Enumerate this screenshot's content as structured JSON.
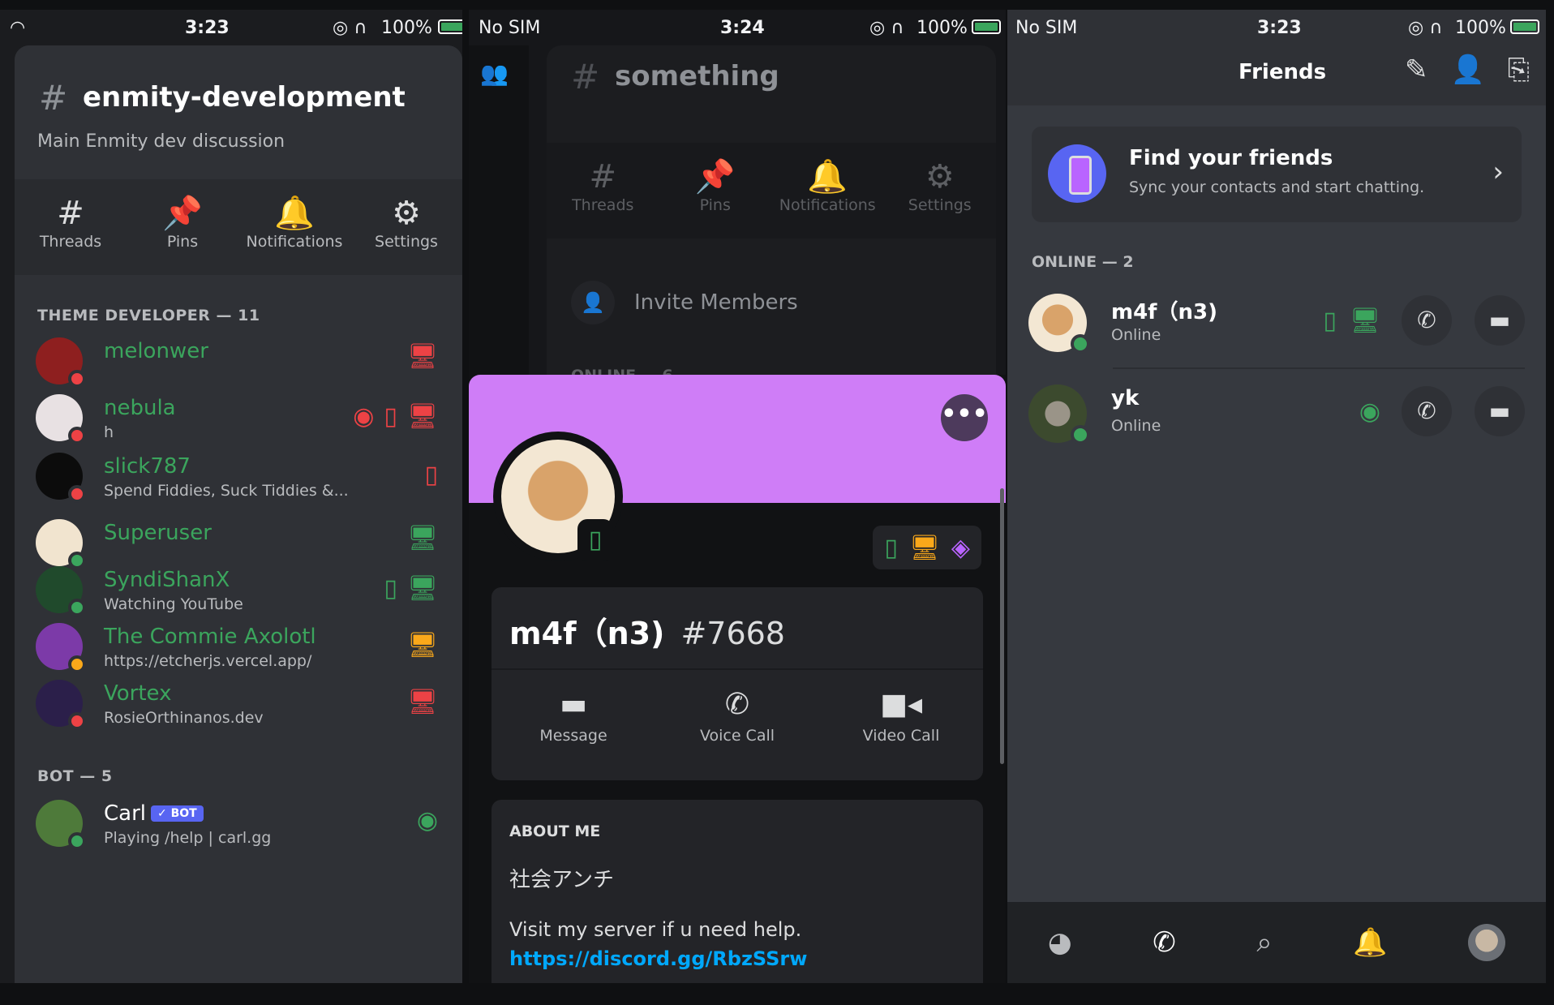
{
  "panel1": {
    "status": {
      "time": "3:23",
      "battery": "100%"
    },
    "channel": {
      "hash": "#",
      "name": "enmity-development",
      "description": "Main Enmity dev discussion"
    },
    "tabs": [
      {
        "label": "Threads",
        "icon": "#"
      },
      {
        "label": "Pins",
        "icon": "📌"
      },
      {
        "label": "Notifications",
        "icon": "🔔"
      },
      {
        "label": "Settings",
        "icon": "⚙"
      }
    ],
    "section_theme": "THEME DEVELOPER — 11",
    "members": [
      {
        "name": "melonwer",
        "sub": ""
      },
      {
        "name": "nebula",
        "sub": "h"
      },
      {
        "name": "slick787",
        "sub": "Spend Fiddies, Suck Tiddies &..."
      },
      {
        "name": "Superuser",
        "sub": ""
      },
      {
        "name": "SyndiShanX",
        "sub": "Watching YouTube"
      },
      {
        "name": "The Commie Axolotl",
        "sub": "https://etcherjs.vercel.app/"
      },
      {
        "name": "Vortex",
        "sub": "RosieOrthinanos.dev"
      }
    ],
    "section_bot": "BOT — 5",
    "bot": {
      "name": "Carl",
      "badge": "✓ BOT",
      "sub": "Playing /help | carl.gg"
    }
  },
  "panel2": {
    "status": {
      "carrier": "No SIM",
      "time": "3:24",
      "battery": "100%"
    },
    "channel": {
      "hash": "#",
      "name": "something"
    },
    "tabs": [
      {
        "label": "Threads",
        "icon": "#"
      },
      {
        "label": "Pins",
        "icon": "📌"
      },
      {
        "label": "Notifications",
        "icon": "🔔"
      },
      {
        "label": "Settings",
        "icon": "⚙"
      }
    ],
    "invite": "Invite Members",
    "online": "ONLINE — 6",
    "profile": {
      "more": "•••",
      "username": "m4f（n3)",
      "discriminator": "#7668",
      "actions": [
        "Message",
        "Voice Call",
        "Video Call"
      ],
      "about_title": "ABOUT ME",
      "about_jp": "社会アンチ",
      "about_text": "Visit my server if u need help.",
      "about_link": "https://discord.gg/RbzSSrw"
    }
  },
  "panel3": {
    "status": {
      "carrier": "No SIM",
      "time": "3:23",
      "battery": "100%"
    },
    "title": "Friends",
    "find": {
      "title": "Find your friends",
      "subtitle": "Sync your contacts and start chatting."
    },
    "online": "ONLINE — 2",
    "friends": [
      {
        "name": "m4f（n3)",
        "status": "Online"
      },
      {
        "name": "yk",
        "status": "Online"
      }
    ]
  },
  "colors": {
    "online": "#3ba55d",
    "dnd": "#ed4245",
    "idle": "#faa81a",
    "blurple": "#5865f2",
    "banner": "#cf7df7",
    "link": "#00a8fc"
  }
}
